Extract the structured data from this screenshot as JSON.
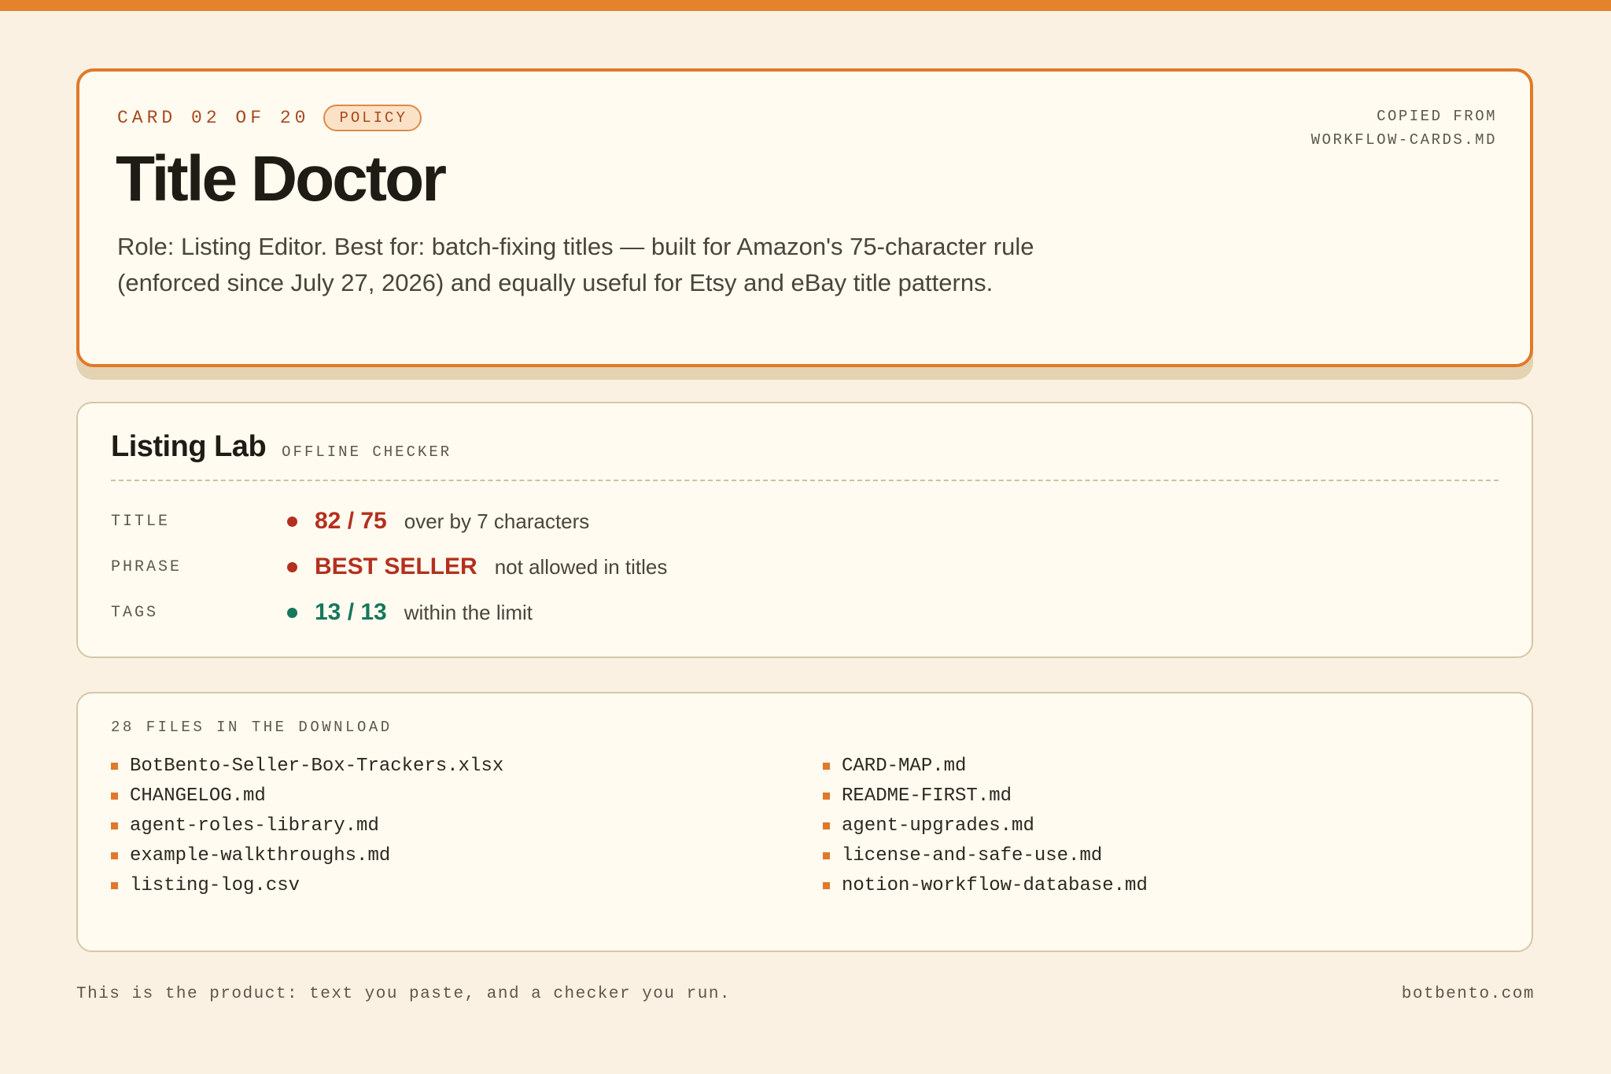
{
  "hero": {
    "card_count": "CARD 02 OF 20",
    "badge": "POLICY",
    "copied_from_line1": "COPIED FROM",
    "copied_from_line2": "WORKFLOW-CARDS.MD",
    "title": "Title Doctor",
    "description": "Role: Listing Editor. Best for: batch-fixing titles — built for Amazon's 75-character rule (enforced since July 27, 2026) and equally useful for Etsy and eBay title patterns."
  },
  "lab": {
    "title": "Listing Lab",
    "subtitle": "OFFLINE CHECKER",
    "rows": [
      {
        "key": "TITLE",
        "value": "82 / 75",
        "note": "over by 7 characters",
        "status": "bad"
      },
      {
        "key": "PHRASE",
        "value": "BEST SELLER",
        "note": "not allowed in titles",
        "status": "bad"
      },
      {
        "key": "TAGS",
        "value": "13 / 13",
        "note": "within the limit",
        "status": "good"
      }
    ]
  },
  "files": {
    "heading": "28 FILES IN THE DOWNLOAD",
    "left": [
      "BotBento-Seller-Box-Trackers.xlsx",
      "CHANGELOG.md",
      "agent-roles-library.md",
      "example-walkthroughs.md",
      "listing-log.csv"
    ],
    "right": [
      "CARD-MAP.md",
      "README-FIRST.md",
      "agent-upgrades.md",
      "license-and-safe-use.md",
      "notion-workflow-database.md"
    ]
  },
  "footer": {
    "tagline": "This is the product: text you paste, and a checker you run.",
    "site": "botbento.com"
  },
  "colors": {
    "accent": "#e5822c",
    "error": "#b4301e",
    "ok": "#16775b",
    "background": "#faf1e2"
  }
}
